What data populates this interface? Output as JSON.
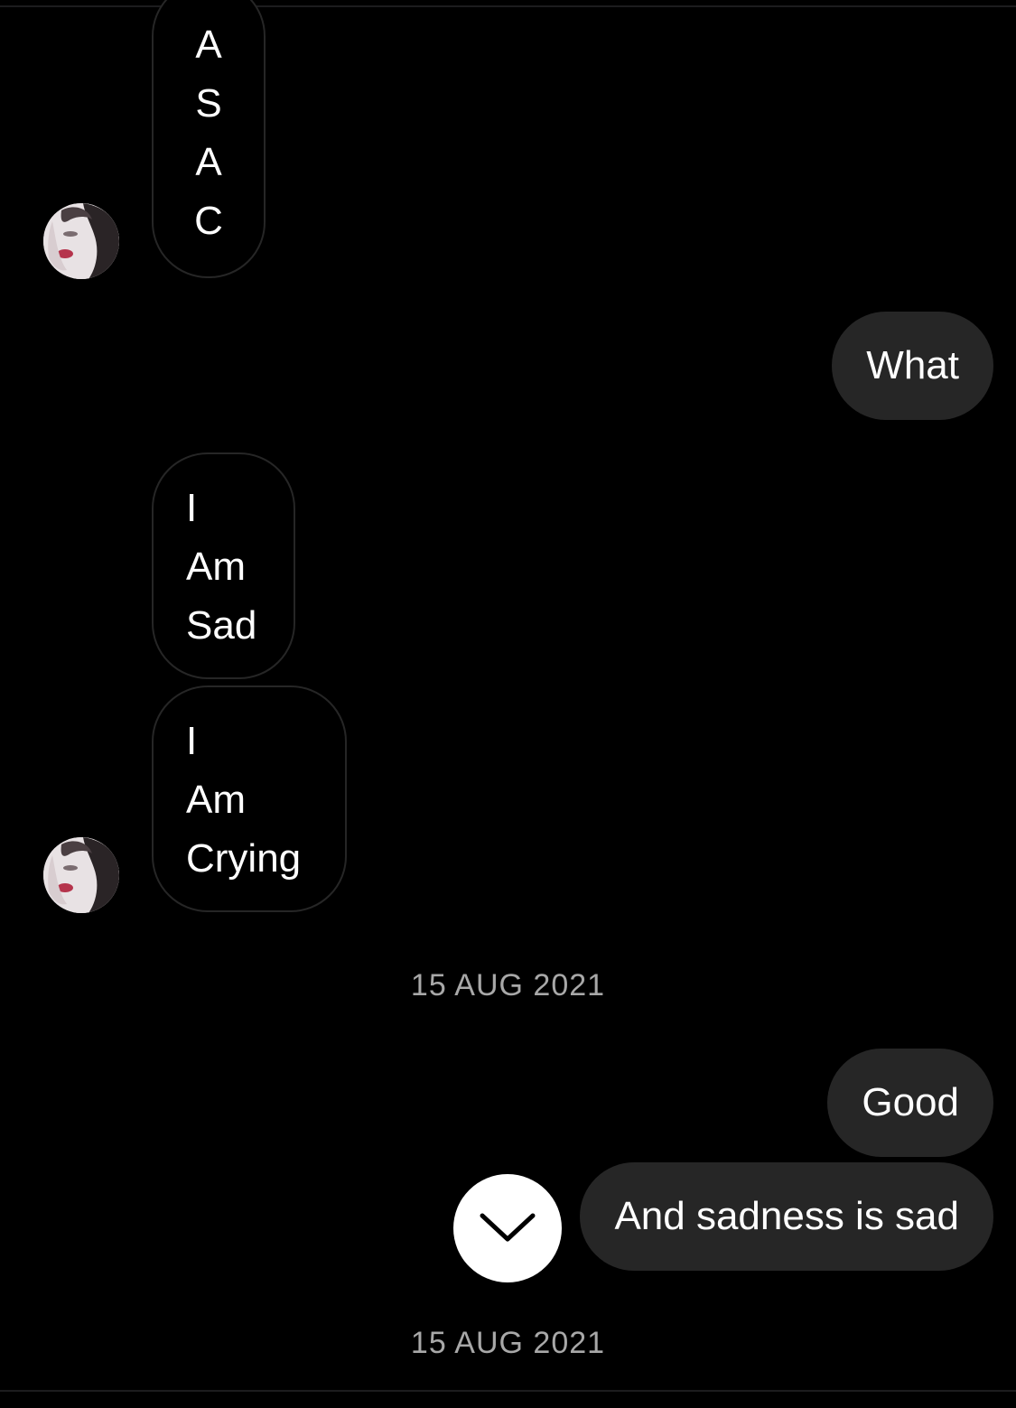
{
  "conversation": {
    "messages": [
      {
        "from": "them",
        "lines": [
          "A",
          "S",
          "A",
          "C"
        ]
      },
      {
        "from": "me",
        "text": "What"
      },
      {
        "from": "them",
        "lines": [
          "I",
          "Am",
          "Sad"
        ]
      },
      {
        "from": "them",
        "lines": [
          "I",
          "Am",
          "Crying"
        ]
      },
      {
        "from": "me",
        "text": "Good"
      },
      {
        "from": "me",
        "text": "And sadness is sad"
      }
    ],
    "date_separators": [
      "15 AUG 2021",
      "15 AUG 2021"
    ]
  },
  "icons": {
    "avatar": "profile-photo",
    "scroll_down": "chevron-down-icon"
  },
  "colors": {
    "background": "#000000",
    "outgoing_bubble": "#262626",
    "incoming_border": "#262626",
    "date_text": "#a8a8a8",
    "scroll_button": "#ffffff"
  }
}
